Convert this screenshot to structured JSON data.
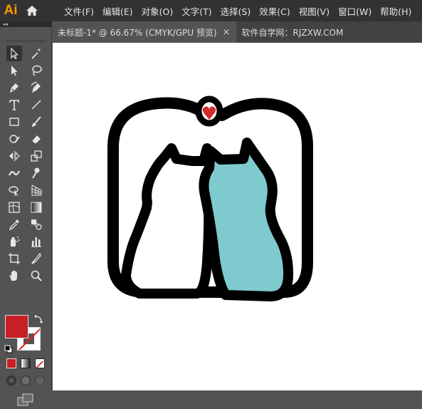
{
  "app": {
    "logo": "Ai"
  },
  "menu": [
    {
      "label": "文件(F)"
    },
    {
      "label": "编辑(E)"
    },
    {
      "label": "对象(O)"
    },
    {
      "label": "文字(T)"
    },
    {
      "label": "选择(S)"
    },
    {
      "label": "效果(C)"
    },
    {
      "label": "视图(V)"
    },
    {
      "label": "窗口(W)"
    },
    {
      "label": "帮助(H)"
    }
  ],
  "tabs": [
    {
      "label": "未标题-1* @ 66.67% (CMYK/GPU 预览)",
      "close": "×"
    },
    {
      "label": "软件自学网：RJZXW.COM"
    }
  ],
  "panel": {
    "collapse": "◂◂"
  },
  "colors": {
    "fill": "#C71F25",
    "stroke": "none",
    "heart": "#D42A2A",
    "right_cat": "#7FCACF",
    "outline": "#000000",
    "ui_accent": "#FF9A00"
  },
  "tools": [
    "selection-tool",
    "magic-wand-tool",
    "direct-selection-tool",
    "lasso-tool",
    "pen-tool",
    "curvature-tool",
    "type-tool",
    "line-segment-tool",
    "rectangle-tool",
    "paintbrush-tool",
    "shaper-tool",
    "eraser-tool",
    "rotate-tool",
    "scale-tool",
    "width-tool",
    "puppet-warp-tool",
    "shape-builder-tool",
    "perspective-grid-tool",
    "mesh-tool",
    "gradient-tool",
    "eyedropper-tool",
    "blend-tool",
    "symbol-sprayer-tool",
    "column-graph-tool",
    "artboard-tool",
    "slice-tool",
    "hand-tool",
    "zoom-tool"
  ]
}
